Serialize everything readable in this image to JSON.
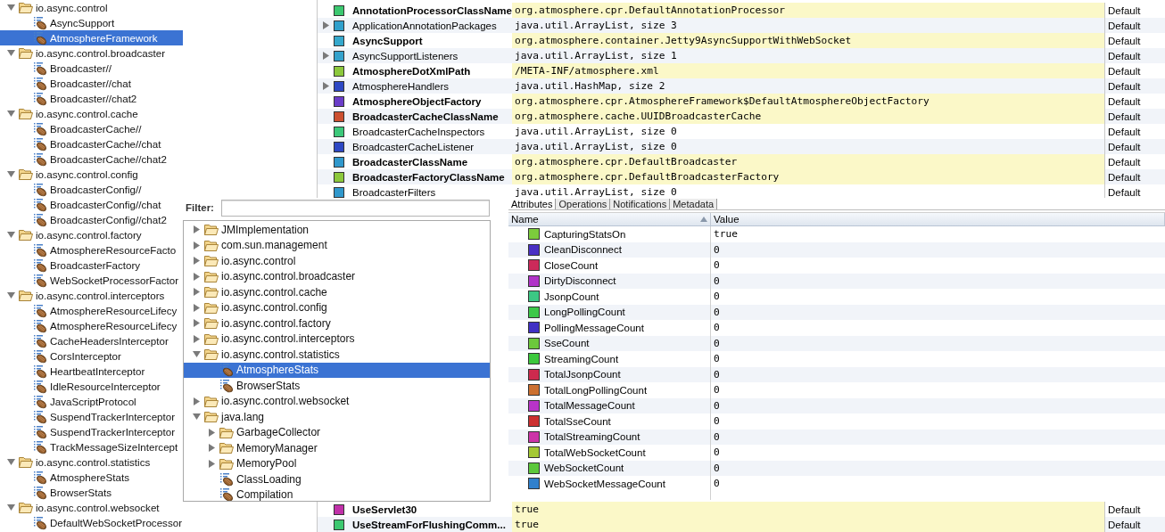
{
  "left_tree": {
    "items": [
      {
        "label": "io.async.control",
        "kind": "folder",
        "expanded": true,
        "selected": false,
        "children": [
          {
            "label": "AsyncSupport",
            "kind": "mbean",
            "selected": false
          },
          {
            "label": "AtmosphereFramework",
            "kind": "mbean",
            "selected": true
          }
        ]
      },
      {
        "label": "io.async.control.broadcaster",
        "kind": "folder",
        "expanded": true,
        "selected": false,
        "children": [
          {
            "label": "Broadcaster//",
            "kind": "mbean",
            "selected": false
          },
          {
            "label": "Broadcaster//chat",
            "kind": "mbean",
            "selected": false
          },
          {
            "label": "Broadcaster//chat2",
            "kind": "mbean",
            "selected": false
          }
        ]
      },
      {
        "label": "io.async.control.cache",
        "kind": "folder",
        "expanded": true,
        "selected": false,
        "children": [
          {
            "label": "BroadcasterCache//",
            "kind": "mbean",
            "selected": false
          },
          {
            "label": "BroadcasterCache//chat",
            "kind": "mbean",
            "selected": false
          },
          {
            "label": "BroadcasterCache//chat2",
            "kind": "mbean",
            "selected": false
          }
        ]
      },
      {
        "label": "io.async.control.config",
        "kind": "folder",
        "expanded": true,
        "selected": false,
        "children": [
          {
            "label": "BroadcasterConfig//",
            "kind": "mbean",
            "selected": false
          },
          {
            "label": "BroadcasterConfig//chat",
            "kind": "mbean",
            "selected": false
          },
          {
            "label": "BroadcasterConfig//chat2",
            "kind": "mbean",
            "selected": false
          }
        ]
      },
      {
        "label": "io.async.control.factory",
        "kind": "folder",
        "expanded": true,
        "selected": false,
        "children": [
          {
            "label": "AtmosphereResourceFacto",
            "kind": "mbean",
            "selected": false
          },
          {
            "label": "BroadcasterFactory",
            "kind": "mbean",
            "selected": false
          },
          {
            "label": "WebSocketProcessorFactor",
            "kind": "mbean",
            "selected": false
          }
        ]
      },
      {
        "label": "io.async.control.interceptors",
        "kind": "folder",
        "expanded": true,
        "selected": false,
        "children": [
          {
            "label": "AtmosphereResourceLifecy",
            "kind": "mbean",
            "selected": false
          },
          {
            "label": "AtmosphereResourceLifecy",
            "kind": "mbean",
            "selected": false
          },
          {
            "label": "CacheHeadersInterceptor",
            "kind": "mbean",
            "selected": false
          },
          {
            "label": "CorsInterceptor",
            "kind": "mbean",
            "selected": false
          },
          {
            "label": "HeartbeatInterceptor",
            "kind": "mbean",
            "selected": false
          },
          {
            "label": "IdleResourceInterceptor",
            "kind": "mbean",
            "selected": false
          },
          {
            "label": "JavaScriptProtocol",
            "kind": "mbean",
            "selected": false
          },
          {
            "label": "SuspendTrackerInterceptor",
            "kind": "mbean",
            "selected": false
          },
          {
            "label": "SuspendTrackerInterceptor",
            "kind": "mbean",
            "selected": false
          },
          {
            "label": "TrackMessageSizeIntercept",
            "kind": "mbean",
            "selected": false
          }
        ]
      },
      {
        "label": "io.async.control.statistics",
        "kind": "folder",
        "expanded": true,
        "selected": false,
        "children": [
          {
            "label": "AtmosphereStats",
            "kind": "mbean",
            "selected": false
          },
          {
            "label": "BrowserStats",
            "kind": "mbean",
            "selected": false
          }
        ]
      },
      {
        "label": "io.async.control.websocket",
        "kind": "folder",
        "expanded": true,
        "selected": false,
        "children": [
          {
            "label": "DefaultWebSocketProcessor",
            "kind": "mbean",
            "selected": false
          }
        ]
      }
    ]
  },
  "attributes_table": {
    "rows_top": [
      {
        "name": "AnnotationProcessorClassName",
        "expandable": false,
        "writable": true,
        "color": "#3cc870",
        "value": "org.atmosphere.cpr.DefaultAnnotationProcessor",
        "source": "Default"
      },
      {
        "name": "ApplicationAnnotationPackages",
        "expandable": true,
        "writable": false,
        "color": "#30a0cc",
        "value": "java.util.ArrayList, size 3",
        "source": "Default"
      },
      {
        "name": "AsyncSupport",
        "expandable": false,
        "writable": true,
        "color": "#35a8cc",
        "value": "org.atmosphere.container.Jetty9AsyncSupportWithWebSocket",
        "source": "Default"
      },
      {
        "name": "AsyncSupportListeners",
        "expandable": true,
        "writable": false,
        "color": "#35a2cc",
        "value": "java.util.ArrayList, size 1",
        "source": "Default"
      },
      {
        "name": "AtmosphereDotXmlPath",
        "expandable": false,
        "writable": true,
        "color": "#8cc83c",
        "value": "/META-INF/atmosphere.xml",
        "source": "Default"
      },
      {
        "name": "AtmosphereHandlers",
        "expandable": true,
        "writable": false,
        "color": "#2d48c4",
        "value": "java.util.HashMap, size 2",
        "source": "Default"
      },
      {
        "name": "AtmosphereObjectFactory",
        "expandable": false,
        "writable": true,
        "color": "#6a3cc8",
        "value": "org.atmosphere.cpr.AtmosphereFramework$DefaultAtmosphereObjectFactory",
        "source": "Default"
      },
      {
        "name": "BroadcasterCacheClassName",
        "expandable": false,
        "writable": true,
        "color": "#cc5030",
        "value": "org.atmosphere.cache.UUIDBroadcasterCache",
        "source": "Default"
      },
      {
        "name": "BroadcasterCacheInspectors",
        "expandable": false,
        "writable": false,
        "color": "#3cc87a",
        "value": "java.util.ArrayList, size 0",
        "source": "Default"
      },
      {
        "name": "BroadcasterCacheListener",
        "expandable": false,
        "writable": false,
        "color": "#2d48c4",
        "value": "java.util.ArrayList, size 0",
        "source": "Default"
      },
      {
        "name": "BroadcasterClassName",
        "expandable": false,
        "writable": true,
        "color": "#3098cc",
        "value": "org.atmosphere.cpr.DefaultBroadcaster",
        "source": "Default"
      },
      {
        "name": "BroadcasterFactoryClassName",
        "expandable": false,
        "writable": true,
        "color": "#8cc83c",
        "value": "org.atmosphere.cpr.DefaultBroadcasterFactory",
        "source": "Default"
      },
      {
        "name": "BroadcasterFilters",
        "expandable": false,
        "writable": false,
        "color": "#3098cc",
        "value": "java.util.ArrayList, size 0",
        "source": "Default"
      }
    ],
    "rows_bottom": [
      {
        "name": "UseServlet30",
        "expandable": false,
        "writable": true,
        "color": "#c030a8",
        "value": "true",
        "source": "Default"
      },
      {
        "name": "UseStreamForFlushingComm...",
        "expandable": false,
        "writable": true,
        "color": "#3cc870",
        "value": "true",
        "source": "Default"
      }
    ]
  },
  "mbean_browser": {
    "filter": {
      "label": "Filter:"
    },
    "tree": [
      {
        "label": "JMImplementation",
        "kind": "folder",
        "expanded": false,
        "selected": false
      },
      {
        "label": "com.sun.management",
        "kind": "folder",
        "expanded": false,
        "selected": false
      },
      {
        "label": "io.async.control",
        "kind": "folder",
        "expanded": false,
        "selected": false
      },
      {
        "label": "io.async.control.broadcaster",
        "kind": "folder",
        "expanded": false,
        "selected": false
      },
      {
        "label": "io.async.control.cache",
        "kind": "folder",
        "expanded": false,
        "selected": false
      },
      {
        "label": "io.async.control.config",
        "kind": "folder",
        "expanded": false,
        "selected": false
      },
      {
        "label": "io.async.control.factory",
        "kind": "folder",
        "expanded": false,
        "selected": false
      },
      {
        "label": "io.async.control.interceptors",
        "kind": "folder",
        "expanded": false,
        "selected": false
      },
      {
        "label": "io.async.control.statistics",
        "kind": "folder",
        "expanded": true,
        "selected": false,
        "children": [
          {
            "label": "AtmosphereStats",
            "kind": "mbean",
            "selected": true
          },
          {
            "label": "BrowserStats",
            "kind": "mbean",
            "selected": false
          }
        ]
      },
      {
        "label": "io.async.control.websocket",
        "kind": "folder",
        "expanded": false,
        "selected": false
      },
      {
        "label": "java.lang",
        "kind": "folder",
        "expanded": true,
        "selected": false,
        "children": [
          {
            "label": "GarbageCollector",
            "kind": "folder",
            "expanded": false,
            "selected": false
          },
          {
            "label": "MemoryManager",
            "kind": "folder",
            "expanded": false,
            "selected": false
          },
          {
            "label": "MemoryPool",
            "kind": "folder",
            "expanded": false,
            "selected": false
          },
          {
            "label": "ClassLoading",
            "kind": "mbean",
            "selected": false
          },
          {
            "label": "Compilation",
            "kind": "mbean",
            "selected": false
          }
        ]
      }
    ]
  },
  "attributes_panel": {
    "tabs": [
      {
        "label": "Attributes",
        "selected": true
      },
      {
        "label": "Operations",
        "selected": false
      },
      {
        "label": "Notifications",
        "selected": false
      },
      {
        "label": "Metadata",
        "selected": false
      }
    ],
    "columns": [
      {
        "label": "Name",
        "sorted": true
      },
      {
        "label": "Value",
        "sorted": false
      }
    ],
    "rows": [
      {
        "name": "CapturingStatsOn",
        "color": "#7ccc3c",
        "value": "true"
      },
      {
        "name": "CleanDisconnect",
        "color": "#4a30c4",
        "value": "0"
      },
      {
        "name": "CloseCount",
        "color": "#cc2a5a",
        "value": "0"
      },
      {
        "name": "DirtyDisconnect",
        "color": "#b034c8",
        "value": "0"
      },
      {
        "name": "JsonpCount",
        "color": "#3cc884",
        "value": "0"
      },
      {
        "name": "LongPollingCount",
        "color": "#3cc84a",
        "value": "0"
      },
      {
        "name": "PollingMessageCount",
        "color": "#4030c4",
        "value": "0"
      },
      {
        "name": "SseCount",
        "color": "#6cc83c",
        "value": "0"
      },
      {
        "name": "StreamingCount",
        "color": "#3cc83c",
        "value": "0"
      },
      {
        "name": "TotalJsonpCount",
        "color": "#cc2a4e",
        "value": "0"
      },
      {
        "name": "TotalLongPollingCount",
        "color": "#cc7030",
        "value": "0"
      },
      {
        "name": "TotalMessageCount",
        "color": "#b834c8",
        "value": "0"
      },
      {
        "name": "TotalSseCount",
        "color": "#cc3030",
        "value": "0"
      },
      {
        "name": "TotalStreamingCount",
        "color": "#cc34a8",
        "value": "0"
      },
      {
        "name": "TotalWebSocketCount",
        "color": "#a4c834",
        "value": "0"
      },
      {
        "name": "WebSocketCount",
        "color": "#5cc83c",
        "value": "0"
      },
      {
        "name": "WebSocketMessageCount",
        "color": "#3080cc",
        "value": "0"
      }
    ]
  }
}
